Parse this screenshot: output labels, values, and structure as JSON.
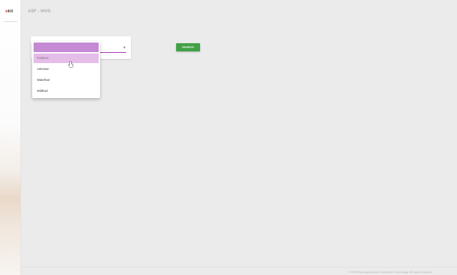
{
  "brand": {
    "logo_prefix": "e",
    "logo_main": "kit",
    "accent_color": "#d0381f"
  },
  "header": {
    "title": "ASF - HIVS"
  },
  "filter": {
    "selected_value": "",
    "options": [
      {
        "label": "Positives",
        "highlighted": true
      },
      {
        "label": "Unknown",
        "highlighted": false
      },
      {
        "label": "Waterfowl",
        "highlighted": false
      },
      {
        "label": "Wildfowl",
        "highlighted": false
      }
    ],
    "accent_color": "#9c27b0"
  },
  "actions": {
    "search_label": "SEARCH",
    "search_color": "#43a047"
  },
  "footer": {
    "text": "© 2020 Rural governance Information Technology. All rights reserved."
  }
}
